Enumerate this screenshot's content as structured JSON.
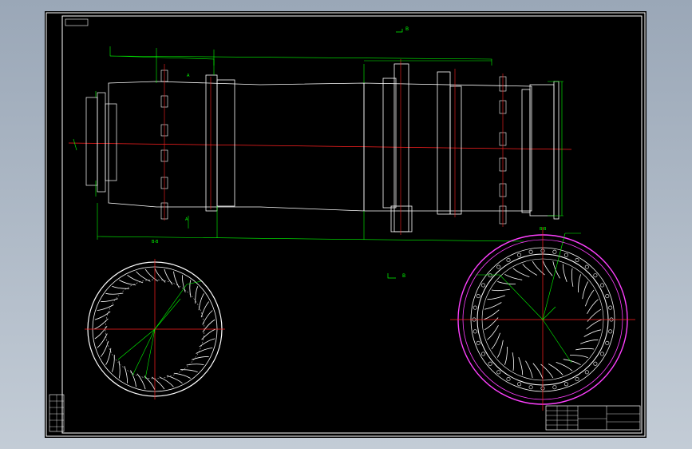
{
  "drawing": {
    "title_tag": "",
    "view_b_top": "B",
    "view_b_bottom": "B",
    "view_a_upper": "A",
    "view_a_lower": "A",
    "section_left_label": "B-B",
    "section_right_label": "B-B"
  },
  "title_block": {
    "left_stamp": "",
    "main_title": "",
    "sub_title": "",
    "drawing_no": ""
  },
  "colors": {
    "geometry": "#ffffff",
    "dimension": "#00ff00",
    "centerline": "#ff2020",
    "hidden": "#ff00ff",
    "sheet": "#000000",
    "background": "#a8b3c1"
  }
}
